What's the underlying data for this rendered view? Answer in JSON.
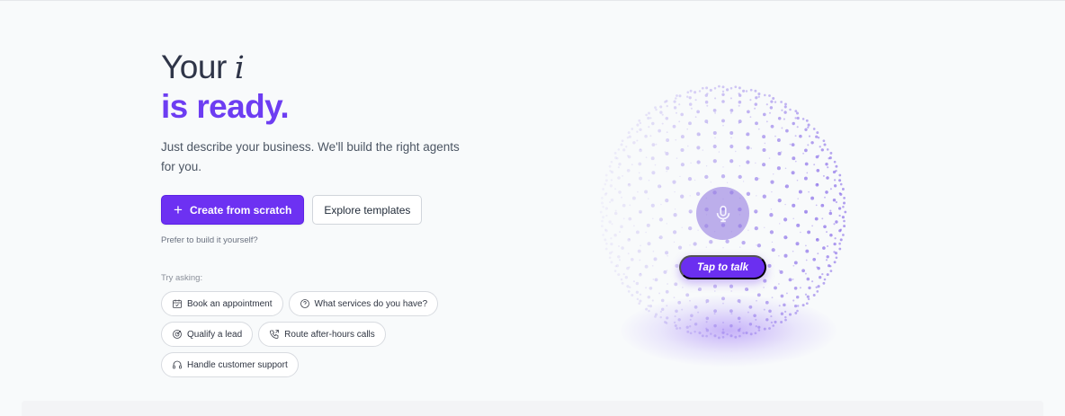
{
  "hero": {
    "title_line1": "Your",
    "title_italic": "i",
    "title_line2": "is ready.",
    "subtitle": "Just describe your business. We'll build the right agents for you."
  },
  "actions": {
    "primary_label": "Create from scratch",
    "secondary_label": "Explore templates",
    "prefer_text": "Prefer to build it yourself?"
  },
  "suggestions": {
    "heading": "Try asking:",
    "items": [
      {
        "label": "Book an appointment",
        "icon": "calendar-icon"
      },
      {
        "label": "What services do you have?",
        "icon": "help-circle-icon"
      },
      {
        "label": "Qualify a lead",
        "icon": "target-icon"
      },
      {
        "label": "Route after-hours calls",
        "icon": "phone-forward-icon"
      },
      {
        "label": "Handle customer support",
        "icon": "headset-icon"
      }
    ]
  },
  "voice": {
    "tap_label": "Tap to talk",
    "mic_icon": "microphone-icon"
  },
  "colors": {
    "accent": "#6d31f2",
    "accent_text": "#6d3df2",
    "orb_dot": "#7c5ce6"
  }
}
